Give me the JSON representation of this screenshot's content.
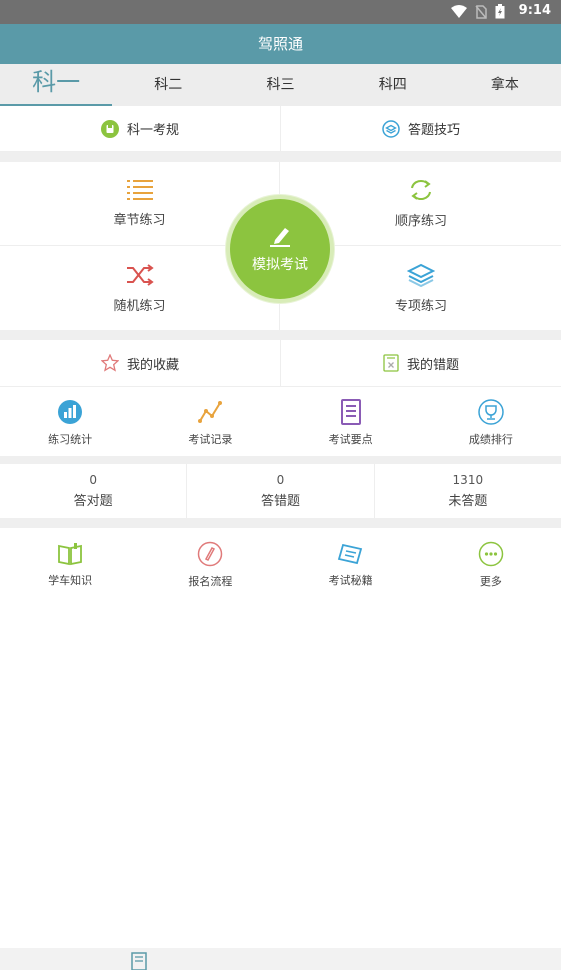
{
  "status_bar": {
    "time": "9:14"
  },
  "app": {
    "title": "驾照通"
  },
  "tabs": [
    {
      "label": "科一",
      "active": true
    },
    {
      "label": "科二"
    },
    {
      "label": "科三"
    },
    {
      "label": "科四"
    },
    {
      "label": "拿本"
    }
  ],
  "links": {
    "rules": "科一考规",
    "tips": "答题技巧"
  },
  "practice": {
    "chapter": "章节练习",
    "sequence": "顺序练习",
    "random": "随机练习",
    "special": "专项练习",
    "mock_exam": "模拟考试"
  },
  "collections": {
    "favorites": "我的收藏",
    "mistakes": "我的错题"
  },
  "tools": [
    {
      "label": "练习统计",
      "icon": "bar-chart-icon"
    },
    {
      "label": "考试记录",
      "icon": "line-chart-icon"
    },
    {
      "label": "考试要点",
      "icon": "document-icon"
    },
    {
      "label": "成绩排行",
      "icon": "trophy-icon"
    }
  ],
  "stats": {
    "correct": {
      "value": "0",
      "label": "答对题"
    },
    "wrong": {
      "value": "0",
      "label": "答错题"
    },
    "unanswered": {
      "value": "1310",
      "label": "未答题"
    }
  },
  "extras": [
    {
      "label": "学车知识",
      "icon": "book-icon"
    },
    {
      "label": "报名流程",
      "icon": "pen-circle-icon"
    },
    {
      "label": "考试秘籍",
      "icon": "notebook-icon"
    },
    {
      "label": "更多",
      "icon": "more-icon"
    }
  ],
  "colors": {
    "primary": "#5a9aa8",
    "accent_green": "#8cc43f",
    "orange": "#e8a33d",
    "red": "#d9534f",
    "blue": "#3ba3d6",
    "purple": "#8a5bb5"
  }
}
